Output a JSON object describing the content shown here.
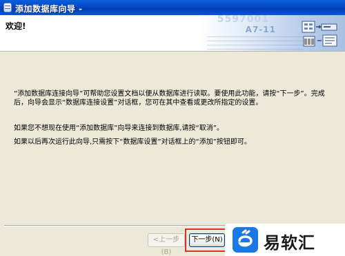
{
  "window": {
    "title": "添加数据库向导 -"
  },
  "banner": {
    "heading": "欢迎!",
    "art_numbers": [
      "5597001",
      "A7-11"
    ]
  },
  "content": {
    "paragraph1": "“添加数据库连接向导”可帮助您设置文档以便从数据库进行读取。要使用此功能，请按“下一步”。完成后，向导会显示“数据库连接设置”对话框，您可在其中查看或更改所指定的设置。",
    "paragraph2": "如果您不想现在使用“添加数据库”向导来连接到数据库,请按“取消”。",
    "paragraph3": "如果以后再次运行此向导,只需按下“数据库设置”对话框上的“添加”按钮即可。"
  },
  "buttons": {
    "back_label": "<上一步(B)",
    "next_label": "下一步(N)"
  },
  "watermark": {
    "text": "易软汇"
  },
  "colors": {
    "titlebar": "#0347c6",
    "highlight": "#d9302a",
    "watermark_logo": "#1a78e6"
  }
}
